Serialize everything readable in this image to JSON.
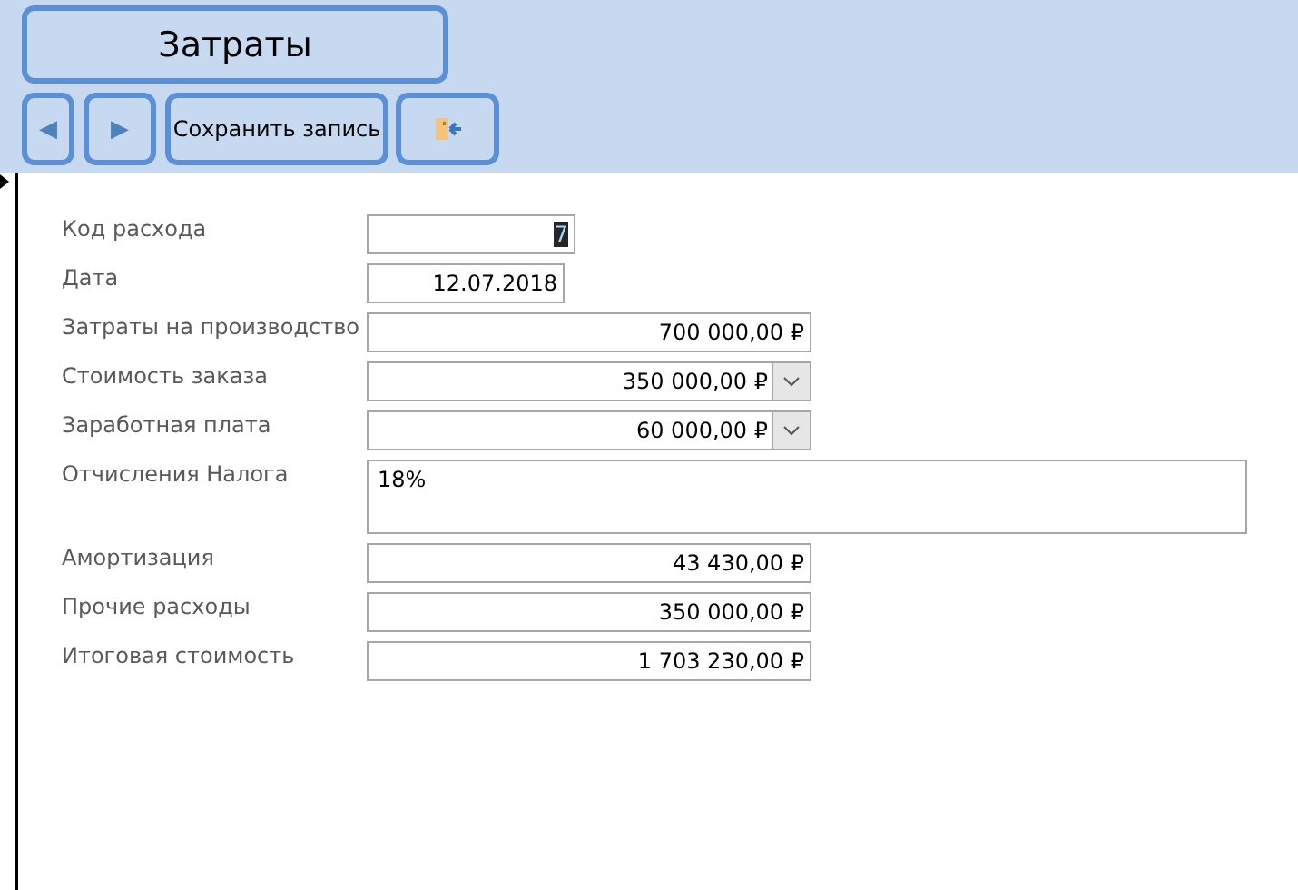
{
  "title": "Затраты",
  "toolbar": {
    "prev": "◀",
    "next": "▶",
    "save": "Сохранить запись"
  },
  "fields": [
    {
      "label": "Код расхода",
      "value": "7",
      "kind": "code",
      "focused": true
    },
    {
      "label": "Дата",
      "value": "12.07.2018",
      "kind": "date",
      "focused": false
    },
    {
      "label": "Затраты на производство",
      "value": "700 000,00 ₽",
      "kind": "number",
      "focused": false
    },
    {
      "label": "Стоимость заказа",
      "value": "350 000,00 ₽",
      "kind": "combo",
      "focused": false
    },
    {
      "label": "Заработная плата",
      "value": "60 000,00 ₽",
      "kind": "combo",
      "focused": false
    },
    {
      "label": "Отчисления Налога",
      "value": "18%",
      "kind": "memo",
      "focused": false
    },
    {
      "label": "Амортизация",
      "value": "43 430,00 ₽",
      "kind": "number",
      "focused": false
    },
    {
      "label": "Прочие расходы",
      "value": "350 000,00 ₽",
      "kind": "number",
      "focused": false
    },
    {
      "label": "Итоговая стоимость",
      "value": "1 703 230,00 ₽",
      "kind": "number",
      "focused": false
    }
  ]
}
